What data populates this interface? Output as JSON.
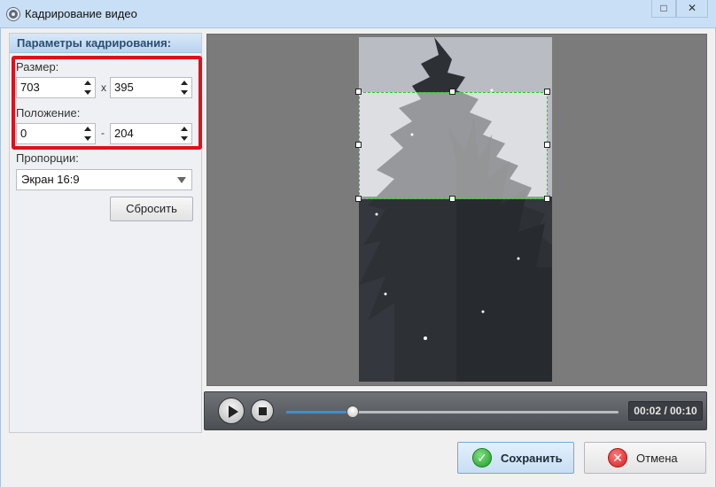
{
  "window": {
    "title": "Кадрирование видео",
    "maximize_glyph": "□",
    "close_glyph": "✕"
  },
  "panel": {
    "header": "Параметры кадрирования:",
    "size_label": "Размер:",
    "width_value": "703",
    "size_separator": "x",
    "height_value": "395",
    "position_label": "Положение:",
    "pos_x_value": "0",
    "position_separator": "-",
    "pos_y_value": "204",
    "proportions_label": "Пропорции:",
    "proportions_selected": "Экран 16:9",
    "reset_button": "Сбросить"
  },
  "player": {
    "time": "00:02 / 00:10",
    "progress": 0.2
  },
  "footer": {
    "save_button": "Сохранить",
    "cancel_button": "Отмена",
    "save_icon_glyph": "✓",
    "cancel_icon_glyph": "✕"
  },
  "colors": {
    "highlight_red": "#e0101a",
    "crop_border": "#1ed11e",
    "progress_blue": "#3b8fd8"
  }
}
